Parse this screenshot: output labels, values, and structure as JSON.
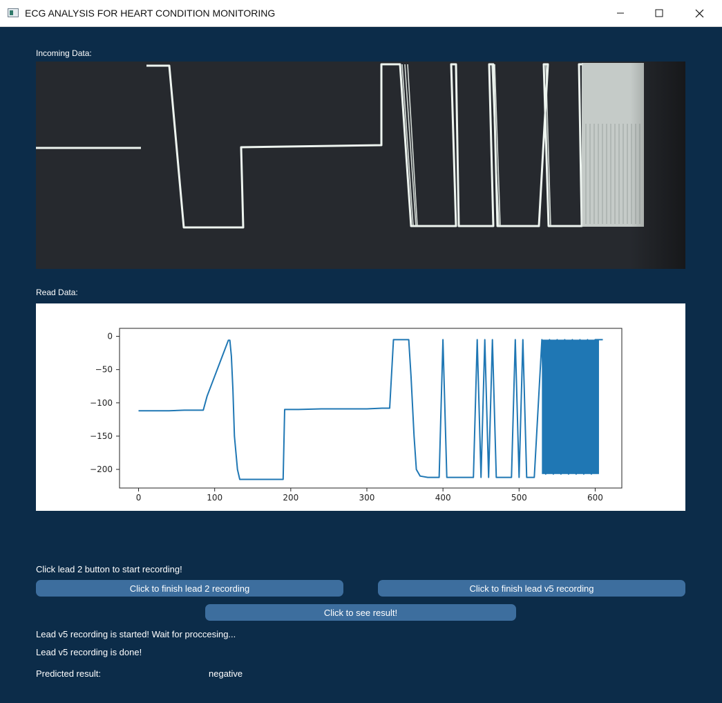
{
  "window": {
    "title": "ECG ANALYSIS FOR HEART CONDITION MONITORING",
    "controls": [
      "minimize-icon",
      "maximize-icon",
      "close-icon"
    ]
  },
  "incoming": {
    "label": "Incoming Data:"
  },
  "read": {
    "label": "Read Data:"
  },
  "chart_data": {
    "type": "line",
    "title": "",
    "xlabel": "",
    "ylabel": "",
    "xlim": [
      -25,
      635
    ],
    "ylim": [
      -228,
      12
    ],
    "xticks": [
      0,
      100,
      200,
      300,
      400,
      500,
      600
    ],
    "yticks": [
      0,
      -50,
      -100,
      -150,
      -200
    ],
    "xtick_labels": [
      "0",
      "100",
      "200",
      "300",
      "400",
      "500",
      "600"
    ],
    "ytick_labels": [
      "0",
      "−50",
      "−100",
      "−150",
      "−200"
    ],
    "grid": false,
    "color": "#1f77b4",
    "series": [
      {
        "x": [
          0,
          10,
          20,
          40,
          60,
          85,
          90,
          100,
          110,
          118,
          120,
          122,
          124,
          126,
          130,
          133,
          135,
          140,
          150,
          170,
          180,
          190,
          192,
          195,
          210,
          240,
          270,
          300,
          320,
          330,
          335,
          340,
          345,
          350,
          355,
          358,
          362,
          365,
          370,
          380,
          395,
          400,
          405,
          410,
          415,
          430,
          440,
          445,
          450,
          455,
          460,
          465,
          470,
          480,
          490,
          495,
          500,
          505,
          510,
          520,
          530,
          535,
          540,
          545,
          550,
          555,
          560,
          565,
          570,
          575,
          580,
          585,
          590,
          595,
          600,
          605,
          610
        ],
        "y": [
          -112,
          -112,
          -112,
          -112,
          -111,
          -111,
          -90,
          -60,
          -30,
          -6,
          -6,
          -30,
          -80,
          -150,
          -200,
          -215,
          -215,
          -215,
          -215,
          -215,
          -215,
          -215,
          -110,
          -110,
          -110,
          -109,
          -109,
          -109,
          -108,
          -108,
          -5,
          -5,
          -5,
          -5,
          -5,
          -60,
          -150,
          -200,
          -210,
          -212,
          -212,
          -5,
          -212,
          -212,
          -212,
          -212,
          -212,
          -5,
          -212,
          -5,
          -212,
          -5,
          -212,
          -212,
          -212,
          -5,
          -212,
          -5,
          -212,
          -212,
          -5,
          -207,
          -5,
          -207,
          -5,
          -207,
          -5,
          -207,
          -5,
          -207,
          -5,
          -207,
          -5,
          -207,
          -5,
          -5,
          -5
        ]
      }
    ]
  },
  "buttons": {
    "lead2": "Click to finish lead 2 recording",
    "v5": "Click to finish lead v5 recording",
    "result": "Click to see result!"
  },
  "status": {
    "instruction": "Click lead 2 button to start recording!",
    "v5_started": "Lead v5 recording is started! Wait for proccesing...",
    "v5_done": "Lead v5 recording is done!",
    "predicted_label": "Predicted result:",
    "predicted_value": "negative"
  }
}
